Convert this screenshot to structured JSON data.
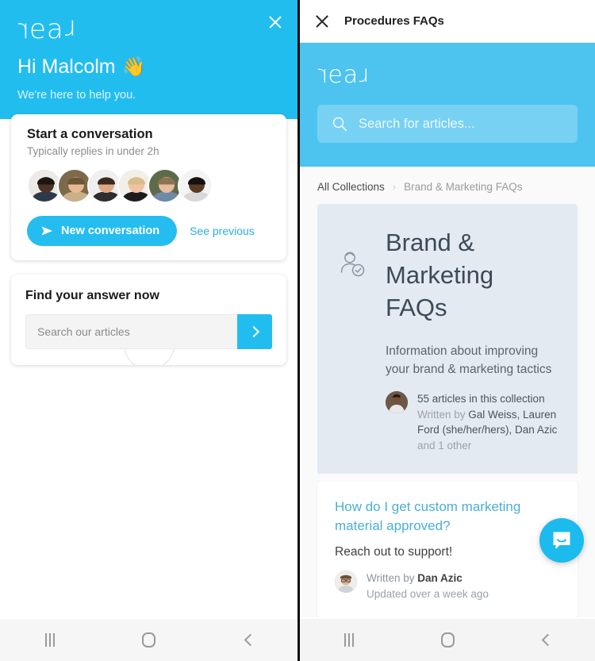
{
  "left_panel": {
    "brand_logo": "real",
    "close_icon": "close-icon",
    "greeting": "Hi Malcolm",
    "wave_emoji": "👋",
    "sub_greeting": "We're here to help you.",
    "conversation_card": {
      "title": "Start a conversation",
      "subtitle": "Typically replies in under 2h",
      "new_conversation_label": "New conversation",
      "see_previous_label": "See previous",
      "avatars": [
        {
          "name": "teammate-1",
          "bg": "#ece9e6",
          "skin": "#4a3327",
          "hair": "#1d1512",
          "cloth": "#2c3a4a"
        },
        {
          "name": "teammate-2",
          "bg": "#7d6a4a",
          "skin": "#e8b894",
          "hair": "#6b5636",
          "cloth": "#c9b089"
        },
        {
          "name": "teammate-3",
          "bg": "#efefef",
          "skin": "#e0a882",
          "hair": "#3a2a20",
          "cloth": "#2e2e30"
        },
        {
          "name": "teammate-4",
          "bg": "#f2efe9",
          "skin": "#eec3a4",
          "hair": "#d9bc8a",
          "cloth": "#1c1c1e"
        },
        {
          "name": "teammate-5",
          "bg": "#5e6b4a",
          "skin": "#e6bda0",
          "hair": "#8d7450",
          "cloth": "#6d8aa8"
        },
        {
          "name": "teammate-6",
          "bg": "#f4f4f4",
          "skin": "#5a3a26",
          "hair": "#15100d",
          "cloth": "#d8d8d8"
        }
      ]
    },
    "find_card": {
      "title": "Find your answer now",
      "search_placeholder": "Search our articles",
      "search_value": "",
      "submit_icon": "chevron-right-icon"
    }
  },
  "right_panel": {
    "topbar": {
      "close_icon": "close-icon",
      "title": "Procedures FAQs"
    },
    "hero": {
      "brand_logo": "real",
      "search_icon": "search-icon",
      "search_placeholder": "Search for articles..."
    },
    "breadcrumb": {
      "root": "All Collections",
      "separator": "›",
      "current": "Brand & Marketing FAQs"
    },
    "collection": {
      "icon": "person-check-icon",
      "title": "Brand & Marketing FAQs",
      "description": "Information about improving your brand & marketing tactics",
      "article_count_text": "55 articles in this collection",
      "written_by_prefix": "Written by ",
      "authors": "Gal Weiss, Lauren Ford (she/her/hers), Dan Azic",
      "authors_suffix": " and 1 other"
    },
    "article": {
      "title": "How do I get custom marketing material approved?",
      "snippet": "Reach out to support!",
      "written_by_prefix": "Written by ",
      "author": "Dan Azic",
      "updated": "Updated over a week ago"
    },
    "launcher": {
      "icon": "chat-bubble-smile-icon"
    }
  },
  "nav_bar": {
    "recents_label": "recents-button",
    "home_label": "home-button",
    "back_label": "back-button"
  },
  "colors": {
    "brand_cyan": "#22BDEF",
    "hero_cyan_light": "#4DC3EF",
    "collection_bg": "#E3EAF2",
    "link_blue": "#4aafd6",
    "page_bg": "#fafafa"
  }
}
